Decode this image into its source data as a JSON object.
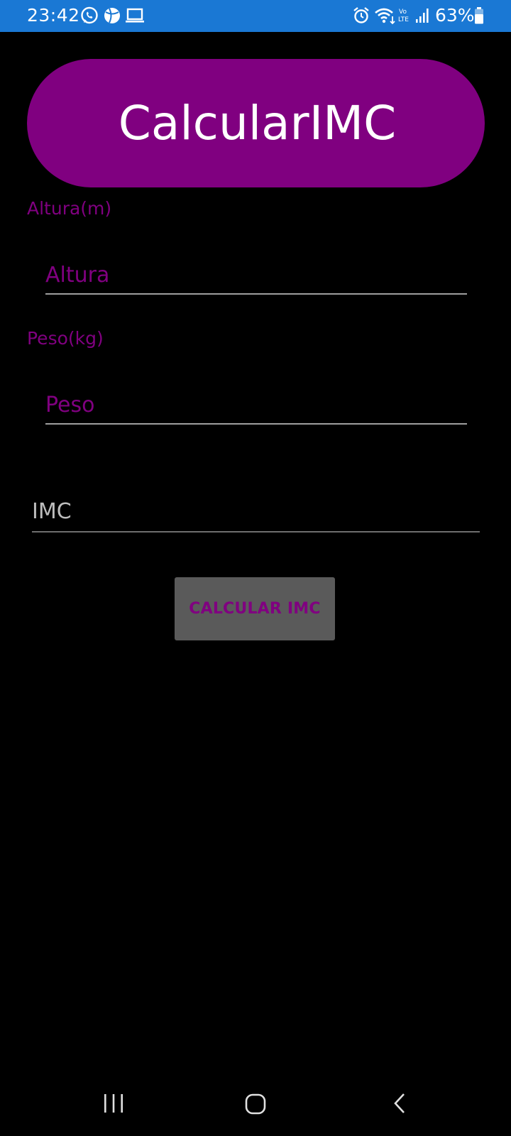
{
  "status_bar": {
    "time": "23:42",
    "battery": "63%",
    "icons": [
      "whatsapp-icon",
      "ball-icon",
      "laptop-icon",
      "alarm-icon",
      "wifi-icon",
      "volte-icon",
      "signal-icon",
      "battery-icon"
    ]
  },
  "app": {
    "title": "CalcularIMC"
  },
  "form": {
    "height_label": "Altura(m)",
    "height_placeholder": "Altura",
    "weight_label": "Peso(kg)",
    "weight_placeholder": "Peso",
    "result_label": "IMC",
    "calculate_button": "CALCULAR IMC"
  },
  "nav_bar": {
    "icons": [
      "recent-apps-icon",
      "home-icon",
      "back-icon"
    ]
  },
  "colors": {
    "status_bar": "#1a78d4",
    "accent_purple": "#800080",
    "background": "#000000",
    "button_gray": "#5a5a5a"
  }
}
